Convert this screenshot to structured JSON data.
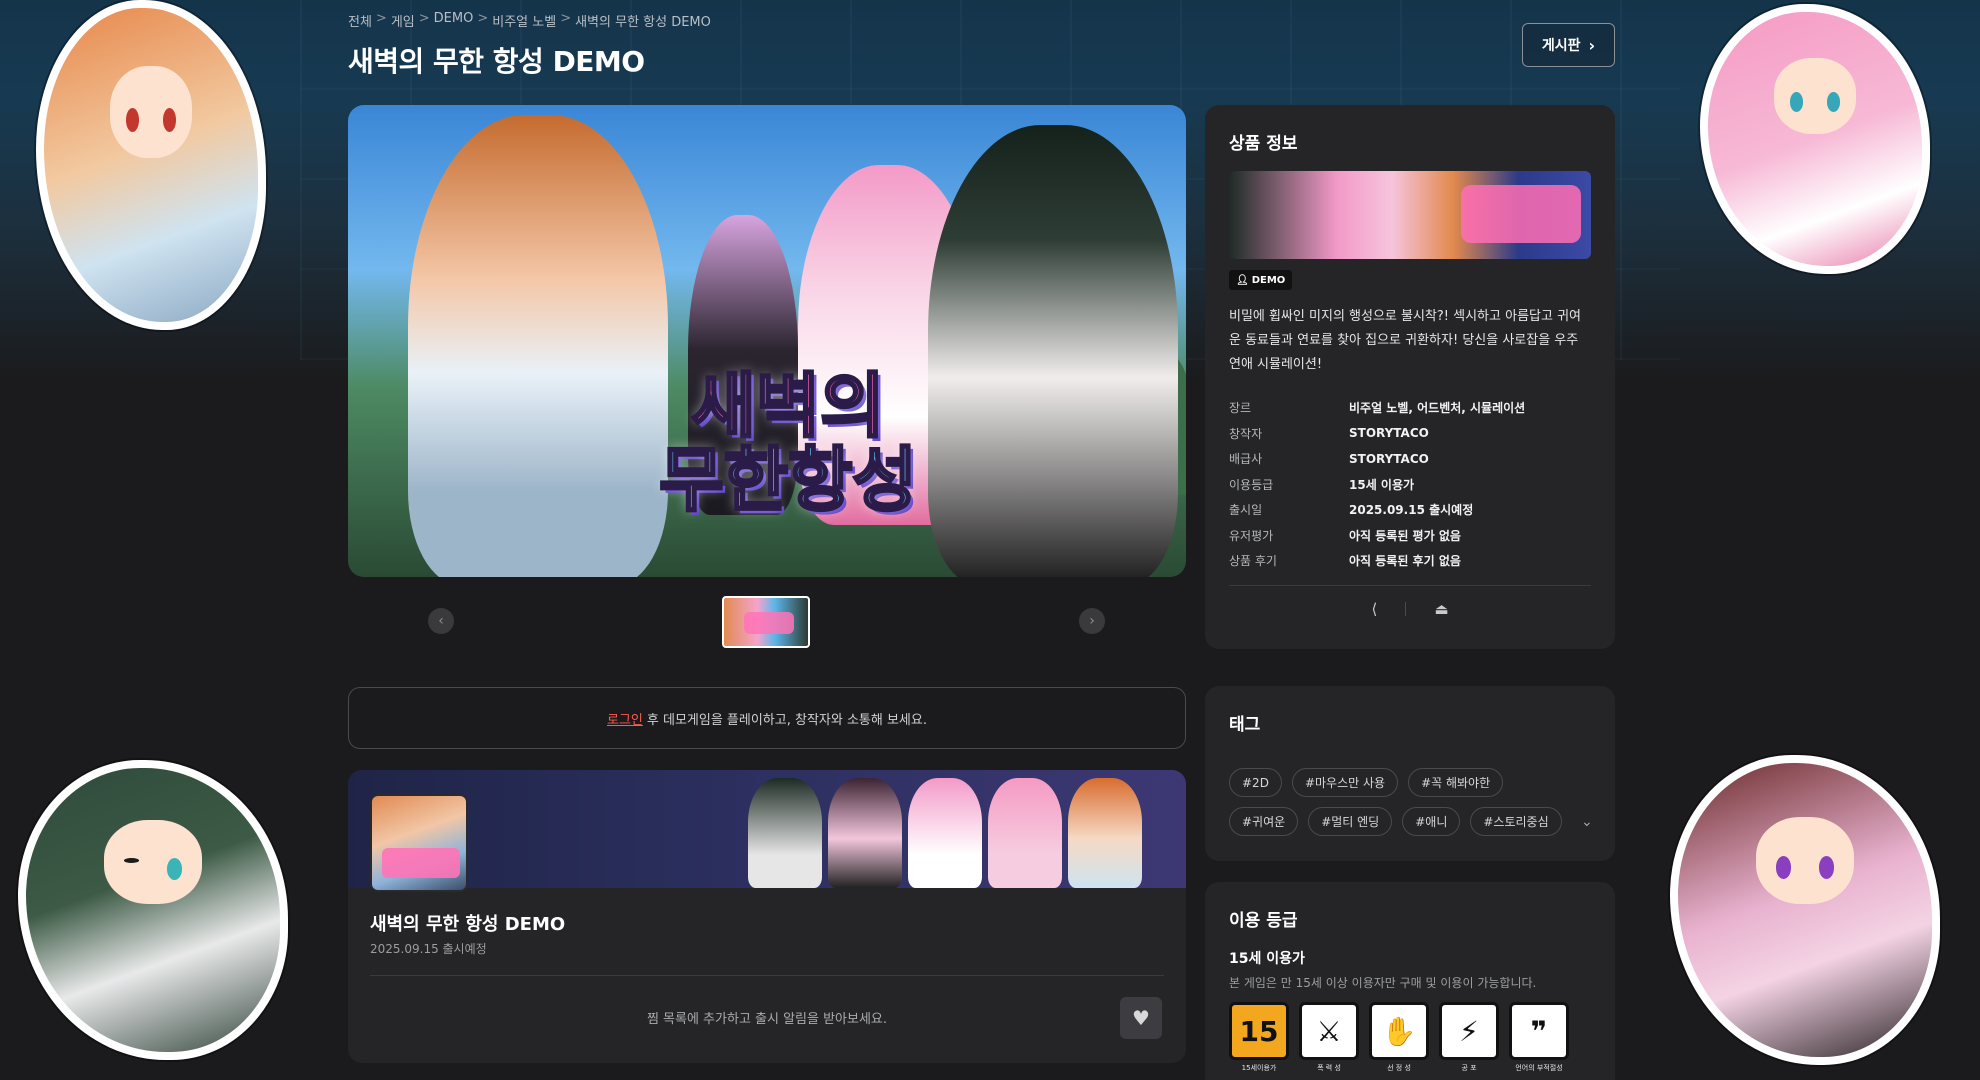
{
  "breadcrumb": [
    "전체",
    "게임",
    "DEMO",
    "비주얼 노벨",
    "새벽의 무한 항성 DEMO"
  ],
  "page_title": "새벽의 무한 항성 DEMO",
  "board_button": "게시판",
  "banner": {
    "logo_line1": "새벽의",
    "logo_line2": "무한항성"
  },
  "gallery": {
    "prev_icon": "chevron-left-icon",
    "next_icon": "chevron-right-icon"
  },
  "login_notice": {
    "link": "로그인",
    "text": "후 데모게임을 플레이하고, 창작자와 소통해 보세요."
  },
  "release": {
    "title": "새벽의 무한 항성 DEMO",
    "date": "2025.09.15 출시예정",
    "wish_text": "찜 목록에 추가하고 출시 알림을 받아보세요.",
    "heart_icon": "heart-icon"
  },
  "product_info": {
    "title": "상품 정보",
    "badge": "DEMO",
    "description": "비밀에 휩싸인 미지의 행성으로 불시착?! 섹시하고 아름답고 귀여운 동료들과 연료를 찾아 집으로 귀환하자! 당신을 사로잡을 우주 연애 시뮬레이션!",
    "rows": [
      {
        "k": "장르",
        "v": "비주얼 노벨, 어드벤처, 시뮬레이션"
      },
      {
        "k": "창작자",
        "v": "STORYTACO"
      },
      {
        "k": "배급사",
        "v": "STORYTACO"
      },
      {
        "k": "이용등급",
        "v": "15세 이용가"
      },
      {
        "k": "출시일",
        "v": "2025.09.15 출시예정"
      },
      {
        "k": "유저평가",
        "v": "아직 등록된 평가 없음"
      },
      {
        "k": "상품 후기",
        "v": "아직 등록된 후기 없음"
      }
    ],
    "share_icon": "share-icon",
    "report_icon": "siren-icon"
  },
  "tags": {
    "title": "태그",
    "items": [
      "#2D",
      "#마우스만 사용",
      "#꼭 해봐야한",
      "#귀여운",
      "#멀티 엔딩",
      "#애니",
      "#스토리중심"
    ]
  },
  "rating": {
    "title": "이용 등급",
    "age": "15세 이용가",
    "note": "본 게임은 만 15세 이상 이용자만 구매 및 이용이 가능합니다.",
    "icons": [
      {
        "glyph": "15",
        "caption": "15세이용가"
      },
      {
        "glyph": "⚔",
        "caption": "폭 력 성"
      },
      {
        "glyph": "✋",
        "caption": "선 정 성"
      },
      {
        "glyph": "⚡",
        "caption": "공 포"
      },
      {
        "glyph": "❞",
        "caption": "언어의 부적절성"
      }
    ]
  },
  "colors": {
    "accent_link": "#ff5a4e",
    "panel_bg": "#252527",
    "page_bg": "#1b1b1d"
  }
}
